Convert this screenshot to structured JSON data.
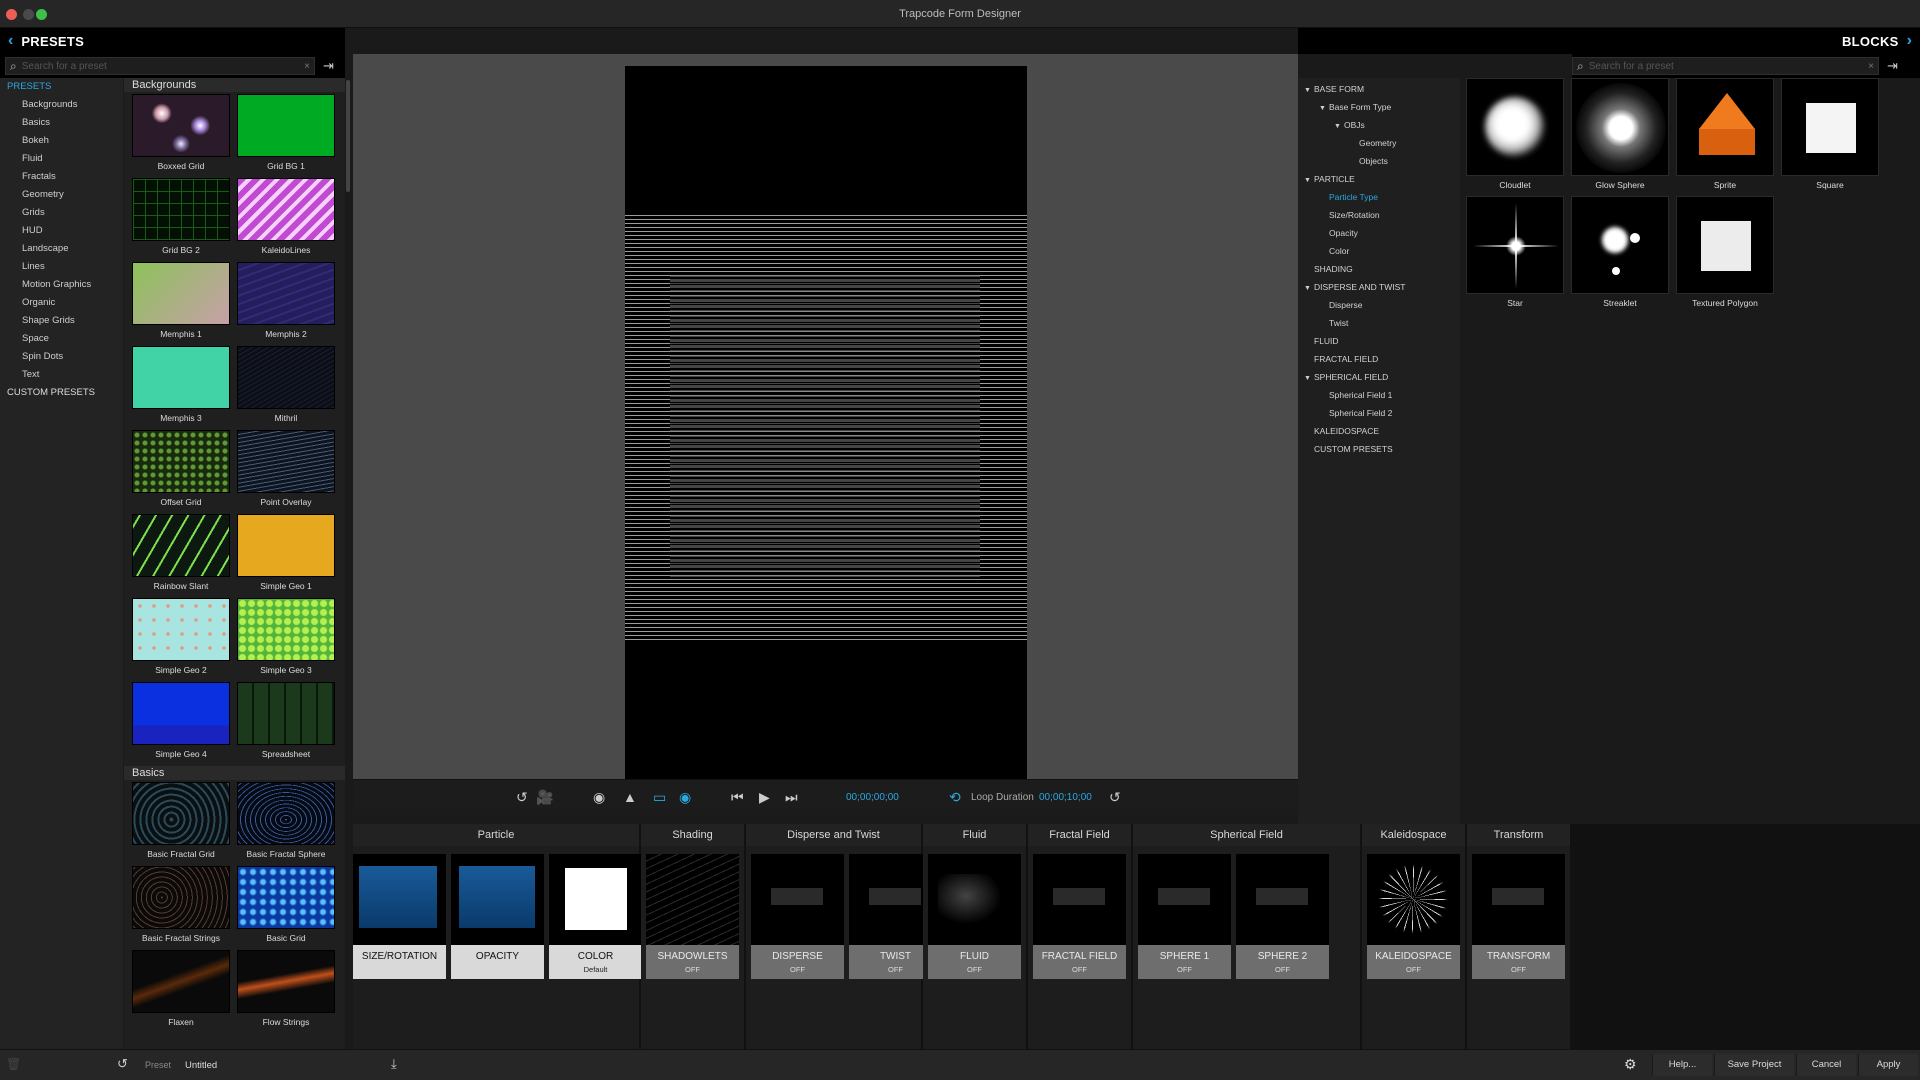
{
  "window": {
    "title": "Trapcode Form Designer"
  },
  "left_header": {
    "label": "PRESETS"
  },
  "right_header": {
    "label": "BLOCKS"
  },
  "left_search": {
    "placeholder": "Search for a preset"
  },
  "right_search": {
    "placeholder": "Search for a preset"
  },
  "nav": {
    "top": "PRESETS",
    "items": [
      "Backgrounds",
      "Basics",
      "Bokeh",
      "Fluid",
      "Fractals",
      "Geometry",
      "Grids",
      "HUD",
      "Landscape",
      "Lines",
      "Motion Graphics",
      "Organic",
      "Shape Grids",
      "Space",
      "Spin Dots",
      "Text"
    ],
    "bottom": "CUSTOM PRESETS"
  },
  "sections": [
    {
      "title": "Backgrounds",
      "tiles": [
        "Boxxed Grid",
        "Grid BG 1",
        "Grid BG 2",
        "KaleidoLines",
        "Memphis 1",
        "Memphis 2",
        "Memphis 3",
        "Mithril",
        "Offset Grid",
        "Point Overlay",
        "Rainbow Slant",
        "Simple Geo 1",
        "Simple Geo 2",
        "Simple Geo 3",
        "Simple Geo 4",
        "Spreadsheet"
      ]
    },
    {
      "title": "Basics",
      "tiles": [
        "Basic Fractal Grid",
        "Basic Fractal Sphere",
        "Basic Fractal Strings",
        "Basic Grid",
        "Flaxen",
        "Flow Strings"
      ]
    }
  ],
  "transport": {
    "timecode": "00;00;00;00",
    "loop_label": "Loop Duration",
    "loop_duration": "00;00;10;00"
  },
  "tree": [
    {
      "label": "BASE FORM",
      "level": 0,
      "arrow": true
    },
    {
      "label": "Base Form Type",
      "level": 1,
      "arrow": true
    },
    {
      "label": "OBJs",
      "level": 2,
      "arrow": true
    },
    {
      "label": "Geometry",
      "level": 3
    },
    {
      "label": "Objects",
      "level": 3
    },
    {
      "label": "PARTICLE",
      "level": 0,
      "arrow": true
    },
    {
      "label": "Particle Type",
      "level": 1,
      "active": true
    },
    {
      "label": "Size/Rotation",
      "level": 1
    },
    {
      "label": "Opacity",
      "level": 1
    },
    {
      "label": "Color",
      "level": 1
    },
    {
      "label": "SHADING",
      "level": 0
    },
    {
      "label": "DISPERSE AND TWIST",
      "level": 0,
      "arrow": true
    },
    {
      "label": "Disperse",
      "level": 1
    },
    {
      "label": "Twist",
      "level": 1
    },
    {
      "label": "FLUID",
      "level": 0
    },
    {
      "label": "FRACTAL FIELD",
      "level": 0
    },
    {
      "label": "SPHERICAL FIELD",
      "level": 0,
      "arrow": true
    },
    {
      "label": "Spherical Field 1",
      "level": 1
    },
    {
      "label": "Spherical Field 2",
      "level": 1
    },
    {
      "label": "KALEIDOSPACE",
      "level": 0
    },
    {
      "label": "CUSTOM PRESETS",
      "level": 0
    }
  ],
  "blocks": [
    "Cloudlet",
    "Glow Sphere",
    "Sprite",
    "Square",
    "Star",
    "Streaklet",
    "Textured Polygon"
  ],
  "lanes": [
    {
      "title": "Particle",
      "cards": [
        {
          "label": "SIZE/ROTATION",
          "sub": ""
        },
        {
          "label": "OPACITY",
          "sub": ""
        },
        {
          "label": "COLOR",
          "sub": "Default"
        }
      ]
    },
    {
      "title": "Shading",
      "cards": [
        {
          "label": "SHADOWLETS",
          "sub": "OFF"
        }
      ]
    },
    {
      "title": "Disperse and Twist",
      "cards": [
        {
          "label": "DISPERSE",
          "sub": "OFF"
        },
        {
          "label": "TWIST",
          "sub": "OFF"
        }
      ]
    },
    {
      "title": "Fluid",
      "cards": [
        {
          "label": "FLUID",
          "sub": "OFF"
        }
      ]
    },
    {
      "title": "Fractal Field",
      "cards": [
        {
          "label": "FRACTAL FIELD",
          "sub": "OFF"
        }
      ]
    },
    {
      "title": "Spherical Field",
      "cards": [
        {
          "label": "SPHERE 1",
          "sub": "OFF"
        },
        {
          "label": "SPHERE 2",
          "sub": "OFF"
        }
      ]
    },
    {
      "title": "Kaleidospace",
      "cards": [
        {
          "label": "KALEIDOSPACE",
          "sub": "OFF"
        }
      ]
    },
    {
      "title": "Transform",
      "cards": [
        {
          "label": "TRANSFORM",
          "sub": "OFF"
        }
      ]
    }
  ],
  "footer": {
    "preset_label": "Preset",
    "preset_name": "Untitled",
    "help": "Help...",
    "save": "Save Project",
    "cancel": "Cancel",
    "apply": "Apply"
  },
  "colors": {
    "accent": "#2aa9e0",
    "panel": "#1f1f1f",
    "viewer": "#4a4a4a"
  }
}
